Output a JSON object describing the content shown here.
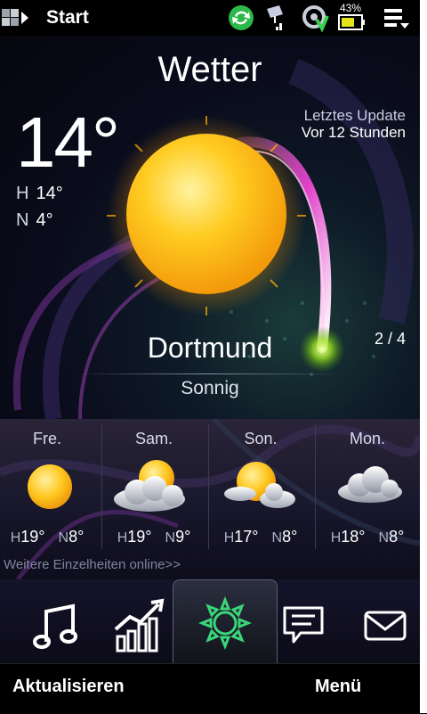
{
  "status_bar": {
    "app_title": "Start",
    "battery_percent": "43%",
    "icons": [
      "windows-start-icon",
      "sync-icon",
      "signal-icon",
      "gps-icon",
      "battery-icon",
      "menu-icon"
    ]
  },
  "weather": {
    "title": "Wetter",
    "temperature": "14°",
    "high_label": "H",
    "high_value": "14°",
    "low_label": "N",
    "low_value": "4°",
    "last_update_label": "Letztes Update",
    "last_update_value": "Vor 12 Stunden",
    "page_indicator": "2 / 4",
    "city": "Dortmund",
    "condition": "Sonnig",
    "condition_icon": "sun-icon"
  },
  "forecast": {
    "days": [
      {
        "name": "Fre.",
        "icon": "sun-icon",
        "high_label": "H",
        "high": "19°",
        "low_label": "N",
        "low": "8°"
      },
      {
        "name": "Sam.",
        "icon": "sun-cloud-icon",
        "high_label": "H",
        "high": "19°",
        "low_label": "N",
        "low": "9°"
      },
      {
        "name": "Son.",
        "icon": "sun-cloud-icon",
        "high_label": "H",
        "high": "17°",
        "low_label": "N",
        "low": "8°"
      },
      {
        "name": "Mon.",
        "icon": "cloud-icon",
        "high_label": "H",
        "high": "18°",
        "low_label": "N",
        "low": "8°"
      }
    ],
    "more_link": "Weitere Einzelheiten online>>"
  },
  "tabs": [
    "music-icon",
    "stocks-icon",
    "weather-icon",
    "messages-icon",
    "mail-icon"
  ],
  "softkeys": {
    "left": "Aktualisieren",
    "right": "Menü"
  },
  "colors": {
    "sun": "#ffc21a",
    "accent_green": "#3ad67a",
    "pink_arc": "#e040c8"
  }
}
